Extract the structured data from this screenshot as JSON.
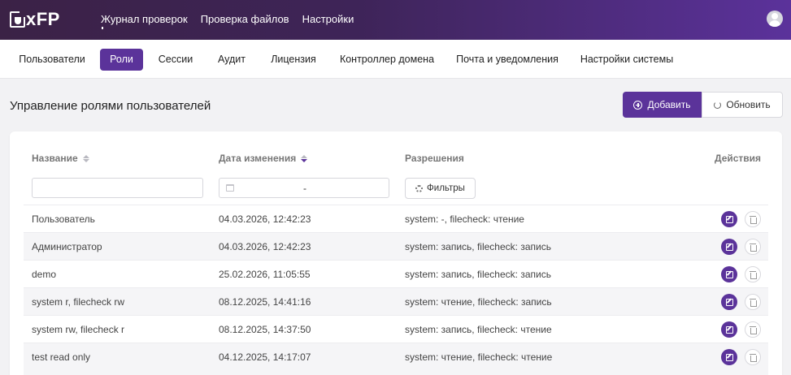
{
  "app": {
    "logo_text": "xFP"
  },
  "topnav": {
    "items": [
      "Журнал проверок",
      "Проверка файлов",
      "Настройки"
    ]
  },
  "subnav": {
    "items": [
      "Пользователи",
      "Роли",
      "Сессии",
      "Аудит",
      "Лицензия",
      "Контроллер домена",
      "Почта и уведомления",
      "Настройки системы"
    ],
    "active": "Роли"
  },
  "page": {
    "title": "Управление ролями пользователей",
    "add_label": "Добавить",
    "refresh_label": "Обновить"
  },
  "table": {
    "headers": {
      "name": "Название",
      "modified": "Дата изменения",
      "permissions": "Разрешения",
      "actions": "Действия"
    },
    "filters": {
      "name_value": "",
      "date_separator": "-",
      "filters_label": "Фильтры"
    },
    "rows": [
      {
        "name": "Пользователь",
        "modified": "04.03.2026, 12:42:23",
        "permissions": "system: -, filecheck: чтение"
      },
      {
        "name": "Администратор",
        "modified": "04.03.2026, 12:42:23",
        "permissions": "system: запись, filecheck: запись"
      },
      {
        "name": "demo",
        "modified": "25.02.2026, 11:05:55",
        "permissions": "system: запись, filecheck: запись"
      },
      {
        "name": "system r, filecheck rw",
        "modified": "08.12.2025, 14:41:16",
        "permissions": "system: чтение, filecheck: запись"
      },
      {
        "name": "system rw, filecheck r",
        "modified": "08.12.2025, 14:37:50",
        "permissions": "system: запись, filecheck: чтение"
      },
      {
        "name": "test read only",
        "modified": "04.12.2025, 14:17:07",
        "permissions": "system: чтение, filecheck: чтение"
      }
    ]
  },
  "colors": {
    "accent": "#5b339a",
    "header_start": "#3b2246",
    "header_end": "#5b329b"
  }
}
